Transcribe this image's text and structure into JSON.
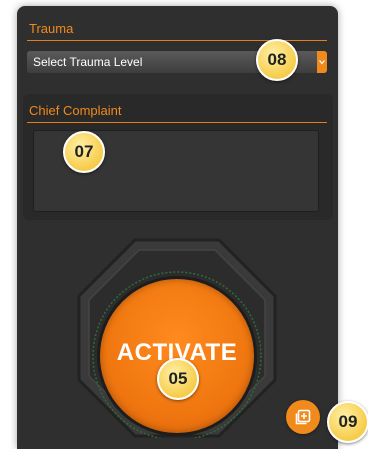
{
  "trauma": {
    "label": "Trauma",
    "select_value": "Select Trauma Level"
  },
  "chief_complaint": {
    "label": "Chief Complaint",
    "value": ""
  },
  "activate": {
    "label": "ACTIVATE"
  },
  "callouts": {
    "trauma_select": "08",
    "chief_complaint": "07",
    "activate": "05",
    "add_button": "09"
  },
  "icons": {
    "select_arrow": "chevron-down-icon",
    "add_button": "add-copy-icon"
  },
  "colors": {
    "accent": "#f08a1c",
    "panel_background": "#2f2f2f",
    "callout_badge": "#f6cc4a"
  }
}
